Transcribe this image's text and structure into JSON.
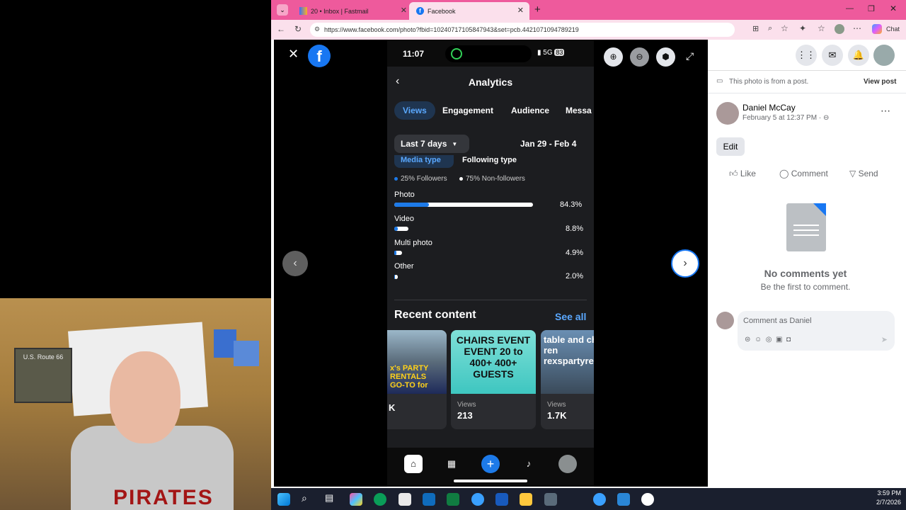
{
  "browser": {
    "tabs": [
      {
        "label": "20 • Inbox | Fastmail"
      },
      {
        "label": "Facebook"
      }
    ],
    "url": "https://www.facebook.com/photo?fbid=10240717105847943&set=pcb.4421071094789219",
    "chat_label": "Chat"
  },
  "phone": {
    "time": "11:07",
    "signal": "5G",
    "battery": "83",
    "title": "Analytics",
    "tabs": [
      "Views",
      "Engagement",
      "Audience",
      "Messa"
    ],
    "range_label": "Last 7 days",
    "date_range": "Jan 29 - Feb 4",
    "subtabs": [
      "Media type",
      "Following type"
    ],
    "followers_label": "25% Followers",
    "nonfollowers_label": "75% Non-followers",
    "media": [
      {
        "label": "Photo",
        "pct": "84.3%",
        "followers_frac": 0.25,
        "total_frac": 0.843
      },
      {
        "label": "Video",
        "pct": "8.8%",
        "followers_frac": 0.25,
        "total_frac": 0.088
      },
      {
        "label": "Multi photo",
        "pct": "4.9%",
        "followers_frac": 0.25,
        "total_frac": 0.049
      },
      {
        "label": "Other",
        "pct": "2.0%",
        "followers_frac": 0.25,
        "total_frac": 0.02
      }
    ],
    "recent_title": "Recent content",
    "see_all": "See all",
    "thumbs": [
      {
        "img_text": "x's PARTY RENTALS GO-TO for",
        "views_label": "",
        "views": "K"
      },
      {
        "img_text": "CHAIRS EVENT EVENT 20 to 400+ 400+ GUESTS",
        "views_label": "Views",
        "views": "213"
      },
      {
        "img_text": "table and chair ren rexspartyrenta",
        "views_label": "Views",
        "views": "1.7K"
      }
    ]
  },
  "panel": {
    "notice": "This photo is from a post.",
    "view_post": "View post",
    "author": "Daniel McCay",
    "date": "February 5 at 12:37 PM",
    "edit": "Edit",
    "like": "Like",
    "comment": "Comment",
    "send": "Send",
    "no_comments": "No comments yet",
    "be_first": "Be the first to comment.",
    "comment_placeholder": "Comment as Daniel"
  },
  "webcam": {
    "sign_text": "U.S. Route 66",
    "shirt_text": "PIRATES"
  },
  "taskbar": {
    "time": "3:59 PM",
    "date": "2/7/2026"
  }
}
